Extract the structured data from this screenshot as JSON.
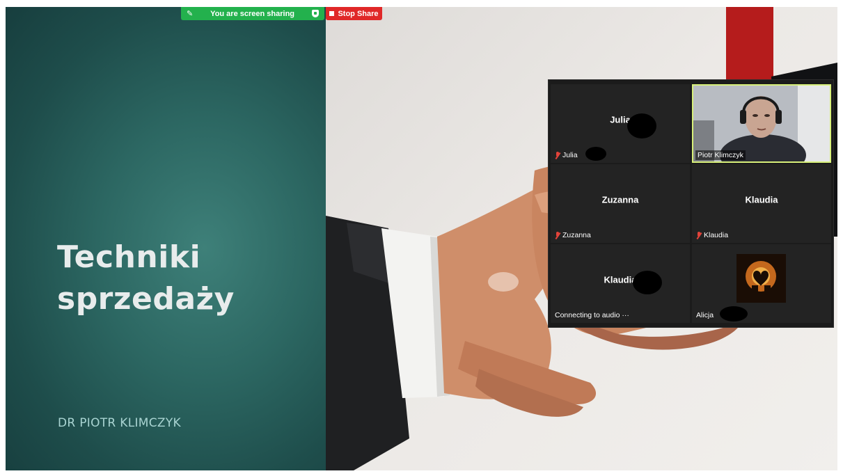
{
  "slide": {
    "title": "Techniki sprzedaży",
    "subtitle": "DR PIOTR KLIMCZYK"
  },
  "share_toolbar": {
    "status_text": "You are screen sharing",
    "stop_label": "Stop Share",
    "colors": {
      "sharing_bar": "#23b14d",
      "stop_button": "#e02828"
    }
  },
  "gallery": {
    "tiles": [
      {
        "center_name": "Julia",
        "footer_label": "Julia",
        "muted": true
      },
      {
        "center_name": "",
        "footer_label": "Piotr Klimczyk",
        "muted": false,
        "video": true,
        "active_speaker": true
      },
      {
        "center_name": "Zuzanna",
        "footer_label": "Zuzanna",
        "muted": true
      },
      {
        "center_name": "Klaudia",
        "footer_label": "Klaudia",
        "muted": true
      },
      {
        "center_name": "Klaudia",
        "footer_label": "Connecting to audio",
        "muted": false
      },
      {
        "center_name": "",
        "footer_label": "Alicja",
        "muted": false,
        "profile_picture": true
      }
    ],
    "colors": {
      "active_speaker_border": "#d8f07a",
      "muted_icon": "#e2433a"
    }
  }
}
